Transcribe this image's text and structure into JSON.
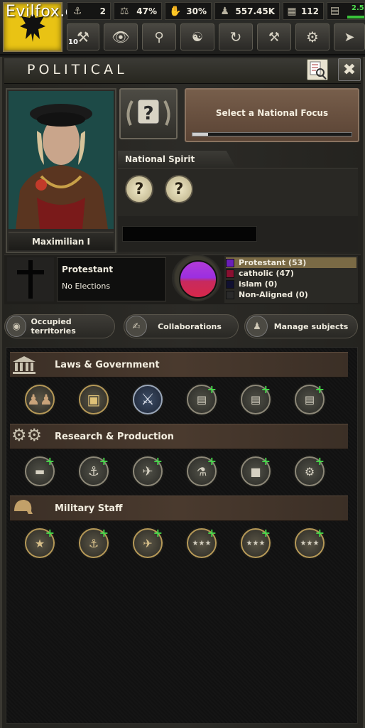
{
  "watermark": "Evilfox.cc",
  "topbar": {
    "resources": [
      {
        "icon": "factory-icon",
        "value": "2"
      },
      {
        "icon": "scales-icon",
        "value": "47%"
      },
      {
        "icon": "arm-strength-icon",
        "value": "30%"
      },
      {
        "icon": "manpower-icon",
        "value": "557.45K"
      },
      {
        "icon": "civilian-factory-icon",
        "value": "112"
      },
      {
        "icon": "convoy-icon",
        "value": "2.5"
      }
    ],
    "political_power_badge": "10",
    "nav_buttons": [
      "political-hammer-icon",
      "intelligence-eye-icon",
      "research-icon",
      "diplomacy-handshake-icon",
      "trade-icon",
      "construction-icon",
      "production-gears-icon",
      "logistics-signpost-icon"
    ]
  },
  "panel": {
    "title": "POLITICAL"
  },
  "leader": {
    "name": "Maximilian I"
  },
  "focus": {
    "label": "Select a National Focus",
    "progress": 0.1
  },
  "national_spirit": {
    "label": "National Spirit",
    "slots": [
      "?",
      "?"
    ]
  },
  "ideology": {
    "name": "Protestant",
    "elections": "No Elections",
    "legend": [
      {
        "label": "Protestant (53)",
        "color": "#6a1fb8",
        "selected": true
      },
      {
        "label": "catholic (47)",
        "color": "#8a1030"
      },
      {
        "label": "islam (0)",
        "color": "#101030"
      },
      {
        "label": "Non-Aligned (0)",
        "color": "#2a2a2a"
      }
    ]
  },
  "actions": [
    {
      "label": "Occupied territories",
      "icon": "globe-icon"
    },
    {
      "label": "Collaborations",
      "icon": "handshake-icon"
    },
    {
      "label": "Manage subjects",
      "icon": "chess-pawn-icon"
    }
  ],
  "sections": [
    {
      "title": "Laws & Government",
      "icon": "government-building-icon"
    },
    {
      "title": "Research & Production",
      "icon": "gears-icon"
    },
    {
      "title": "Military Staff",
      "icon": "helmet-icon"
    }
  ]
}
